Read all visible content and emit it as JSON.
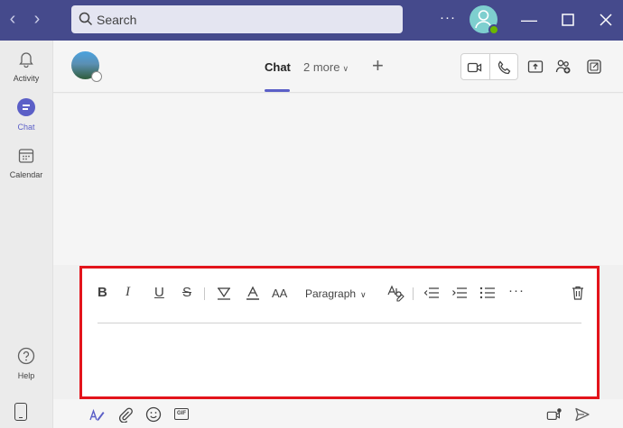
{
  "search": {
    "placeholder": "Search"
  },
  "titlebar": {
    "more_label": "···"
  },
  "rail": {
    "items": [
      {
        "label": "Activity",
        "icon": "bell-icon"
      },
      {
        "label": "Chat",
        "icon": "chat-icon",
        "active": true
      },
      {
        "label": "Calendar",
        "icon": "calendar-icon"
      },
      {
        "label": "Help",
        "icon": "help-icon"
      }
    ]
  },
  "header": {
    "tab_chat": "Chat",
    "tab_more": "2 more",
    "tab_add": "+"
  },
  "compose": {
    "bold": "B",
    "italic": "I",
    "underline": "U",
    "strike": "S",
    "font_size": "AA",
    "paragraph": "Paragraph",
    "more": "···"
  },
  "colors": {
    "titlebar": "#454a8c",
    "accent": "#5b5fc7",
    "highlight_border": "#e3141b"
  }
}
